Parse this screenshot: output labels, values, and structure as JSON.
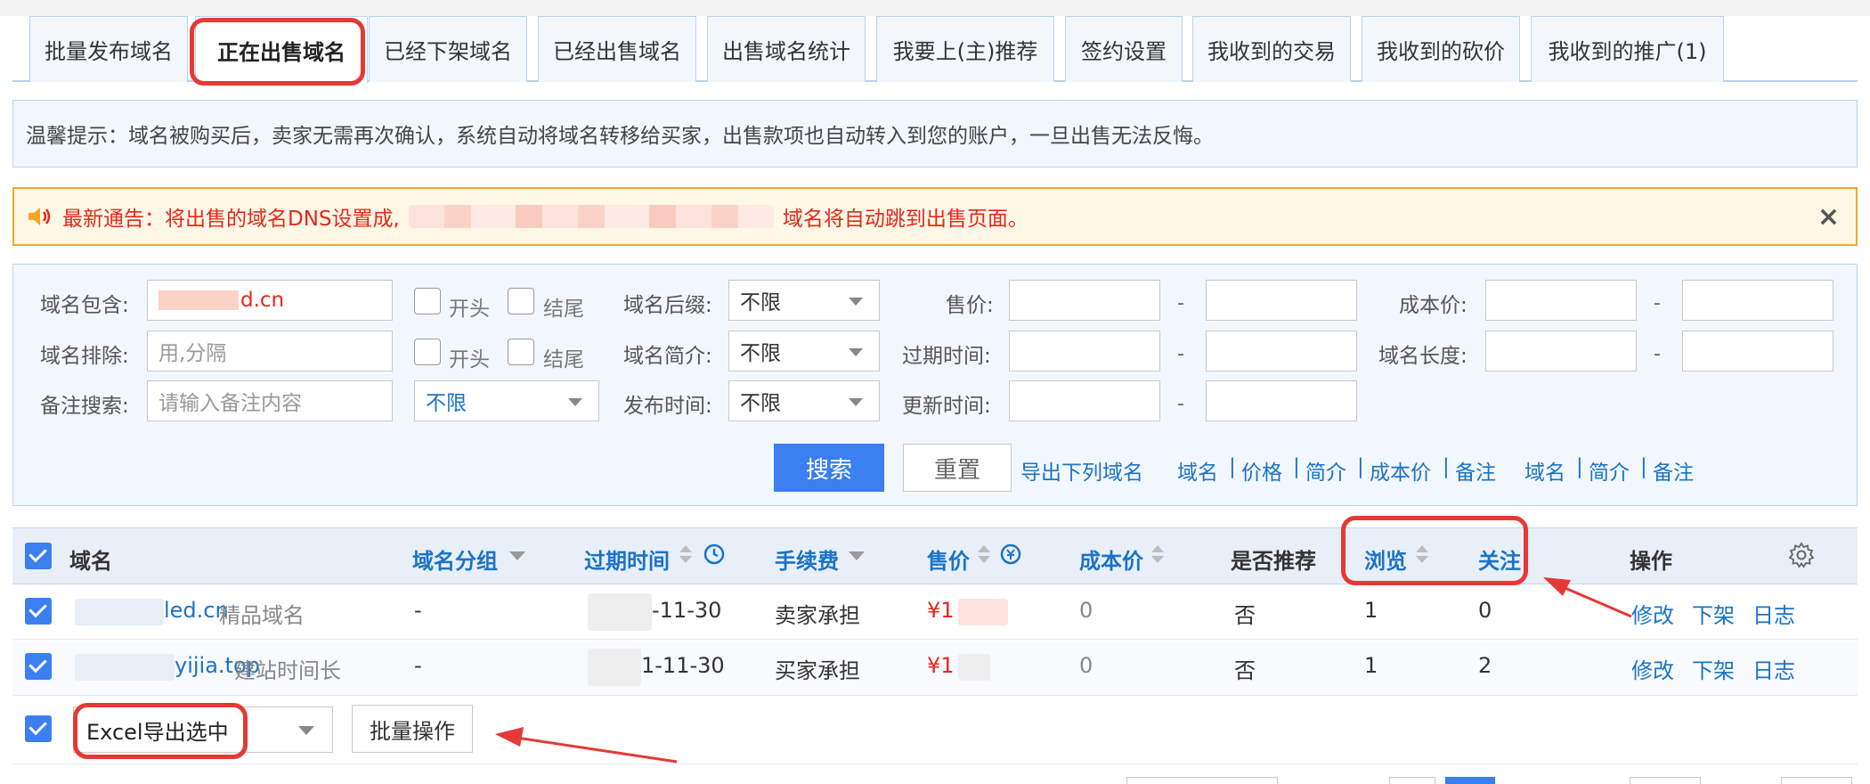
{
  "tabs": [
    {
      "label": "批量发布域名",
      "active": false
    },
    {
      "label": "正在出售域名",
      "active": true
    },
    {
      "label": "已经下架域名",
      "active": false
    },
    {
      "label": "已经出售域名",
      "active": false
    },
    {
      "label": "出售域名统计",
      "active": false
    },
    {
      "label": "我要上(主)推荐",
      "active": false
    },
    {
      "label": "签约设置",
      "active": false
    },
    {
      "label": "我收到的交易",
      "active": false
    },
    {
      "label": "我收到的砍价",
      "active": false
    },
    {
      "label": "我收到的推广(1)",
      "active": false
    }
  ],
  "tip": "温馨提示：域名被购买后，卖家无需再次确认，系统自动将域名转移给买家，出售款项也自动转入到您的账户，一旦出售无法反悔。",
  "alert": {
    "prefix": "最新通告：将出售的域名DNS设置成,",
    "suffix": "域名将自动跳到出售页面。",
    "close": "×"
  },
  "filters": {
    "contains_label": "域名包含:",
    "contains_value": "d.cn",
    "exclude_label": "域名排除:",
    "exclude_placeholder": "用,分隔",
    "note_label": "备注搜索:",
    "note_placeholder": "请输入备注内容",
    "start_label": "开头",
    "end_label": "结尾",
    "note_select": "不限",
    "suffix_label": "域名后缀:",
    "suffix_value": "不限",
    "intro_label": "域名简介:",
    "intro_value": "不限",
    "publish_label": "发布时间:",
    "publish_value": "不限",
    "price_label": "售价:",
    "expire_label": "过期时间:",
    "update_label": "更新时间:",
    "cost_label": "成本价:",
    "length_label": "域名长度:",
    "dash": "-",
    "search_button": "搜索",
    "reset_button": "重置",
    "export_link": "导出下列域名",
    "export_fields_a": [
      "域名",
      "价格",
      "简介",
      "成本价",
      "备注"
    ],
    "export_fields_b": [
      "域名",
      "简介",
      "备注"
    ],
    "separator": "|"
  },
  "table": {
    "headers": {
      "domain": "域名",
      "group": "域名分组",
      "expire": "过期时间",
      "fee": "手续费",
      "price": "售价",
      "cost": "成本价",
      "recommend": "是否推荐",
      "views": "浏览",
      "follows": "关注",
      "action": "操作"
    },
    "rows": [
      {
        "domain": "led.cn",
        "intro": "精品域名",
        "group": "-",
        "expire": "-11-30",
        "fee": "卖家承担",
        "price": "¥1",
        "cost": "0",
        "recommend": "否",
        "views": "1",
        "follows": "0"
      },
      {
        "domain": "yijia.top",
        "intro": "建站时间长",
        "group": "-",
        "expire": "1-11-30",
        "fee": "买家承担",
        "price": "¥1",
        "cost": "0",
        "recommend": "否",
        "views": "1",
        "follows": "2"
      }
    ],
    "actions": [
      "修改",
      "下架",
      "日志"
    ]
  },
  "footer": {
    "export_select": "Excel导出选中",
    "batch_button": "批量操作"
  },
  "colors": {
    "accent": "#3b7ff0",
    "link": "#1a73c8",
    "alert_text": "#e8261c",
    "highlight": "#e53935"
  }
}
